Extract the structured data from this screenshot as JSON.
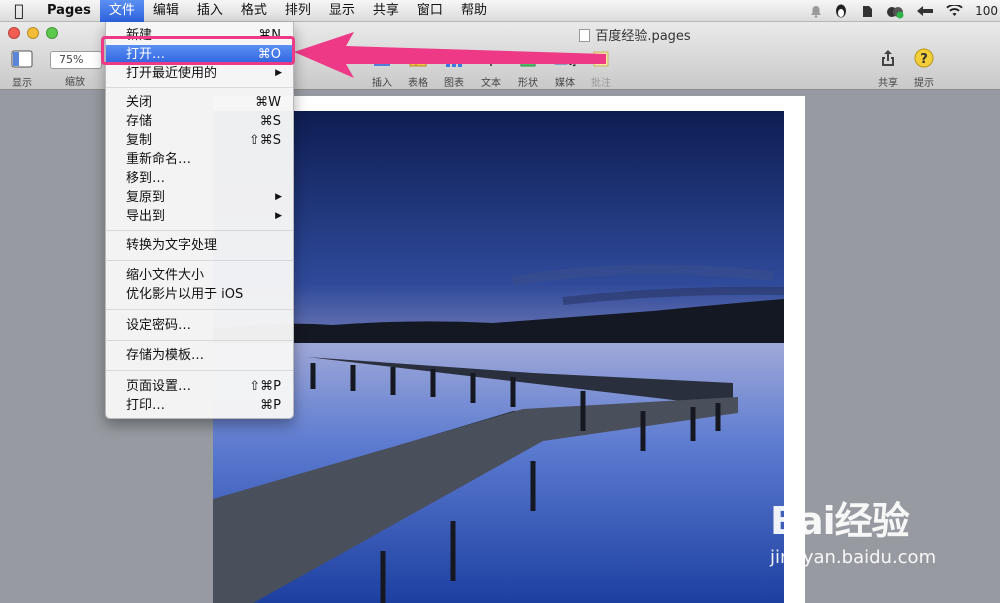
{
  "menubar": {
    "app_name": "Pages",
    "items": [
      "文件",
      "编辑",
      "插入",
      "格式",
      "排列",
      "显示",
      "共享",
      "窗口",
      "帮助"
    ],
    "battery_text": "100"
  },
  "window": {
    "title": "百度经验.pages"
  },
  "toolbar": {
    "view_label": "显示",
    "zoom_value": "75%",
    "zoom_label": "缩放",
    "insert_label": "插入",
    "table_label": "表格",
    "chart_label": "图表",
    "text_label": "文本",
    "shape_label": "形状",
    "media_label": "媒体",
    "comment_label": "批注",
    "share_label": "共享",
    "tips_label": "提示"
  },
  "file_menu": {
    "items": [
      {
        "label": "新建…",
        "shortcut": "⌘N"
      },
      {
        "label": "打开…",
        "shortcut": "⌘O"
      },
      {
        "label": "打开最近使用的",
        "shortcut": "▶"
      },
      {
        "label": "关闭",
        "shortcut": "⌘W"
      },
      {
        "label": "存储",
        "shortcut": "⌘S"
      },
      {
        "label": "复制",
        "shortcut": "⇧⌘S"
      },
      {
        "label": "重新命名…",
        "shortcut": ""
      },
      {
        "label": "移到…",
        "shortcut": ""
      },
      {
        "label": "复原到",
        "shortcut": "▶"
      },
      {
        "label": "导出到",
        "shortcut": "▶"
      },
      {
        "label": "转换为文字处理",
        "shortcut": ""
      },
      {
        "label": "缩小文件大小",
        "shortcut": ""
      },
      {
        "label": "优化影片以用于 iOS",
        "shortcut": ""
      },
      {
        "label": "设定密码…",
        "shortcut": ""
      },
      {
        "label": "存储为模板…",
        "shortcut": ""
      },
      {
        "label": "页面设置…",
        "shortcut": "⇧⌘P"
      },
      {
        "label": "打印…",
        "shortcut": "⌘P"
      }
    ]
  },
  "watermark": {
    "logo": "Bai经验",
    "url": "jingyan.baidu.com"
  },
  "colors": {
    "highlight": "#3b71e8",
    "annotation": "#ee3a86"
  }
}
